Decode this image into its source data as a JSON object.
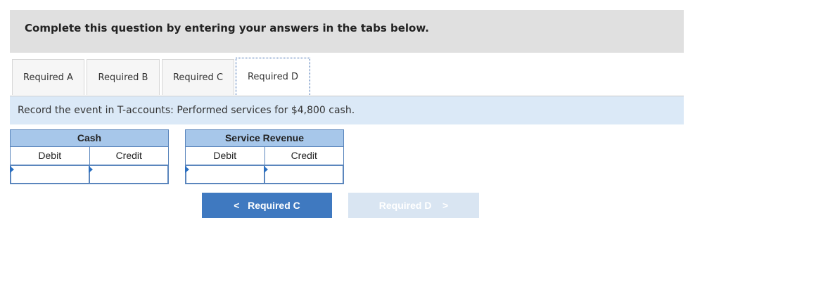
{
  "header": {
    "title": "Complete this question by entering your answers in the tabs below."
  },
  "tabs": [
    {
      "label": "Required A",
      "active": false
    },
    {
      "label": "Required B",
      "active": false
    },
    {
      "label": "Required C",
      "active": false
    },
    {
      "label": "Required D",
      "active": true
    }
  ],
  "instruction": "Record the event in T-accounts: Performed services for $4,800 cash.",
  "taccounts": [
    {
      "name": "Cash",
      "debit_label": "Debit",
      "credit_label": "Credit",
      "debit_value": "",
      "credit_value": ""
    },
    {
      "name": "Service Revenue",
      "debit_label": "Debit",
      "credit_label": "Credit",
      "debit_value": "",
      "credit_value": ""
    }
  ],
  "nav": {
    "prev_label": "Required C",
    "next_label": "Required D",
    "prev_chevron": "<",
    "next_chevron": ">"
  },
  "colors": {
    "accent": "#3f79c0",
    "disabled_button": "#d9e5f2",
    "account_header": "#a7c7ea",
    "instruction_bg": "#dbe9f7"
  }
}
